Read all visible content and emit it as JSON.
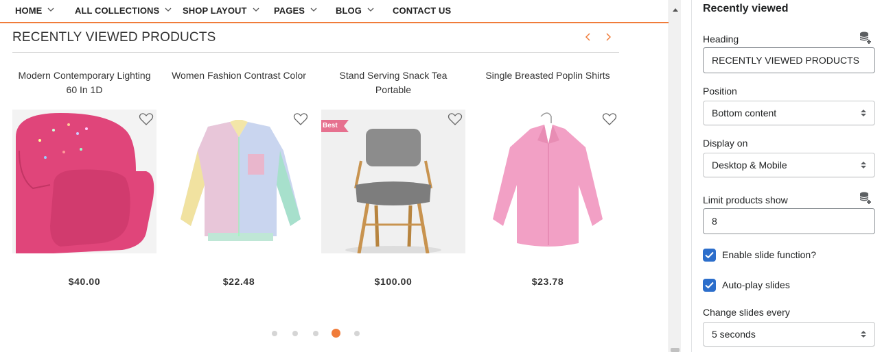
{
  "nav": {
    "items": [
      {
        "label": "HOME",
        "has_dropdown": true
      },
      {
        "label": "ALL COLLECTIONS",
        "has_dropdown": true
      },
      {
        "label": "SHOP LAYOUT",
        "has_dropdown": true
      },
      {
        "label": "PAGES",
        "has_dropdown": true
      },
      {
        "label": "BLOG",
        "has_dropdown": true
      },
      {
        "label": "CONTACT US",
        "has_dropdown": false
      }
    ],
    "accent_color": "#f07c3a"
  },
  "section": {
    "title": "RECENTLY VIEWED PRODUCTS",
    "prev_icon": "chevron-left-icon",
    "next_icon": "chevron-right-icon"
  },
  "products": [
    {
      "name": "Modern Contemporary Lighting 60 In 1D",
      "price": "$40.00",
      "image": "pink-armchair",
      "badge": ""
    },
    {
      "name": "Women Fashion Contrast Color",
      "price": "$22.48",
      "image": "pastel-color-block-shirt",
      "badge": ""
    },
    {
      "name": "Stand Serving Snack Tea Portable",
      "price": "$100.00",
      "image": "grey-wooden-chair",
      "badge": "Best"
    },
    {
      "name": "Single Breasted Poplin Shirts",
      "price": "$23.78",
      "image": "pink-poplin-shirt",
      "badge": ""
    }
  ],
  "pagination": {
    "count": 5,
    "active_index": 3
  },
  "panel": {
    "title": "Recently viewed",
    "heading": {
      "label": "Heading",
      "value": "RECENTLY VIEWED PRODUCTS"
    },
    "position": {
      "label": "Position",
      "value": "Bottom content"
    },
    "display_on": {
      "label": "Display on",
      "value": "Desktop & Mobile"
    },
    "limit": {
      "label": "Limit products show",
      "value": "8"
    },
    "enable_slide": {
      "label": "Enable slide function?",
      "checked": true
    },
    "autoplay": {
      "label": "Auto-play slides",
      "checked": true
    },
    "change_every": {
      "label": "Change slides every",
      "value": "5 seconds"
    },
    "checkbox_color": "#2c6ecb"
  }
}
